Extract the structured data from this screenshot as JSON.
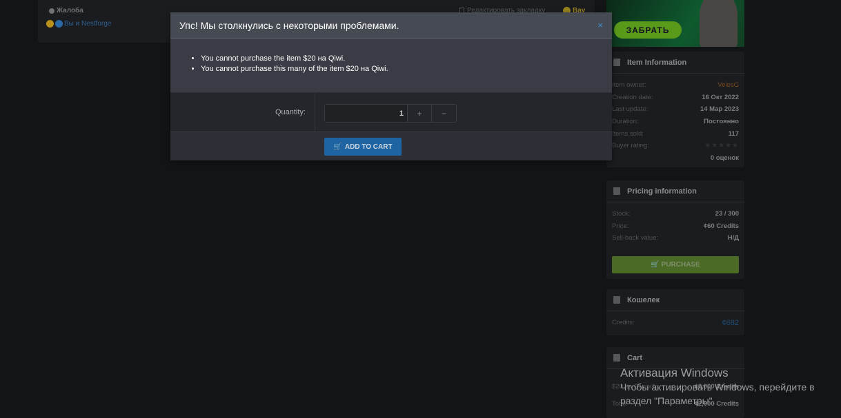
{
  "post": {
    "report": "Жалоба",
    "reactions": "Вы и Nestforge",
    "bookmark": "Редактировать закладку",
    "reaction_label": "Вау"
  },
  "dialog": {
    "title": "Упс! Мы столкнулись с некоторыми проблемами.",
    "close": "×",
    "errors": [
      "You cannot purchase the item $20 на Qiwi.",
      "You cannot purchase this many of the item $20 на Qiwi."
    ],
    "quantity_label": "Quantity:",
    "quantity": "1",
    "plus": "+",
    "minus": "−",
    "add_to_cart": "ADD TO CART"
  },
  "banner": {
    "button": "ЗАБРАТЬ"
  },
  "item_info": {
    "title": "Item Information",
    "rows": [
      [
        "Item owner:",
        "VelesG"
      ],
      [
        "Creation date:",
        "16 Окт 2022"
      ],
      [
        "Last update:",
        "14 Мар 2023"
      ],
      [
        "Duration:",
        "Постоянно"
      ],
      [
        "Items sold:",
        "117"
      ],
      [
        "Buyer rating:",
        ""
      ]
    ],
    "rating": 0,
    "stars": "★★★★★",
    "ratings_count": "0 оценок"
  },
  "pricing": {
    "title": "Pricing information",
    "rows": [
      [
        "Stock:",
        "23 / 300"
      ],
      [
        "Price:",
        "¢60 Credits"
      ],
      [
        "Sell-back value:",
        "Н/Д"
      ]
    ],
    "purchase": "PURCHASE"
  },
  "wallet": {
    "title": "Кошелек",
    "label": "Credits:",
    "value": "¢682"
  },
  "cart": {
    "title": "Cart",
    "rows": [
      [
        "$20 на Qiwi x1:",
        "¢2,000 Credits"
      ],
      [
        "Total:",
        "¢2,000 Credits"
      ]
    ]
  },
  "watermark": {
    "line1": "Активация Windows",
    "line2": "Чтобы активировать Windows, перейдите в",
    "line3": "раздел \"Параметры\"."
  },
  "colors": {
    "accent": "#1e64a3",
    "purchase": "#4a6a25",
    "owner": "#7a4a1e",
    "credits": "#1e4f7a"
  }
}
